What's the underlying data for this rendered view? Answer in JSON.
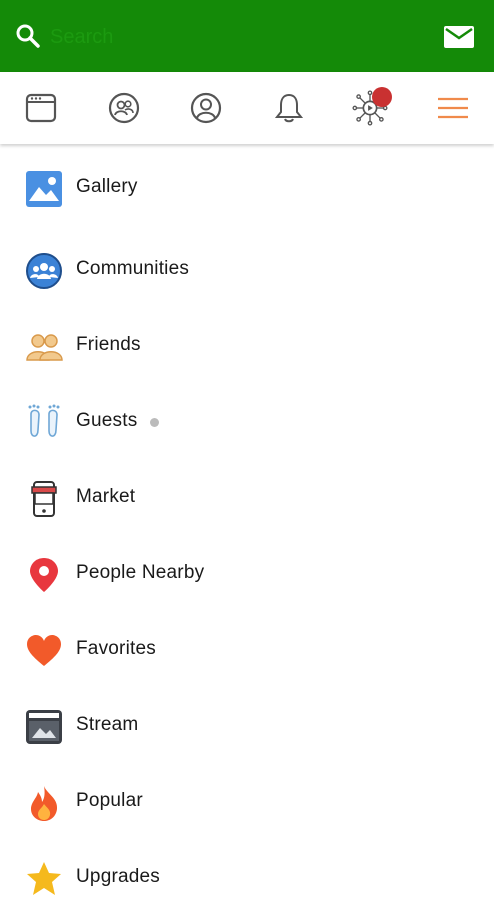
{
  "header": {
    "search_placeholder": "Search",
    "brand_color": "#148a08"
  },
  "nav": {
    "items": [
      {
        "name": "feed",
        "icon": "browser-window-icon"
      },
      {
        "name": "communities",
        "icon": "group-circle-icon"
      },
      {
        "name": "profile",
        "icon": "user-circle-icon"
      },
      {
        "name": "notifications",
        "icon": "bell-icon"
      },
      {
        "name": "activity",
        "icon": "network-play-icon"
      },
      {
        "name": "menu",
        "icon": "hamburger-icon"
      }
    ],
    "active_color": "#f08a4b"
  },
  "menu": {
    "items": [
      {
        "label": "Gallery",
        "icon": "gallery-icon"
      },
      {
        "label": "Communities",
        "icon": "communities-icon"
      },
      {
        "label": "Friends",
        "icon": "friends-icon"
      },
      {
        "label": "Guests",
        "icon": "footprints-icon"
      },
      {
        "label": "Market",
        "icon": "market-icon"
      },
      {
        "label": "People Nearby",
        "icon": "location-pin-icon"
      },
      {
        "label": "Favorites",
        "icon": "heart-icon"
      },
      {
        "label": "Stream",
        "icon": "stream-icon"
      },
      {
        "label": "Popular",
        "icon": "flame-icon"
      },
      {
        "label": "Upgrades",
        "icon": "star-icon"
      }
    ]
  }
}
